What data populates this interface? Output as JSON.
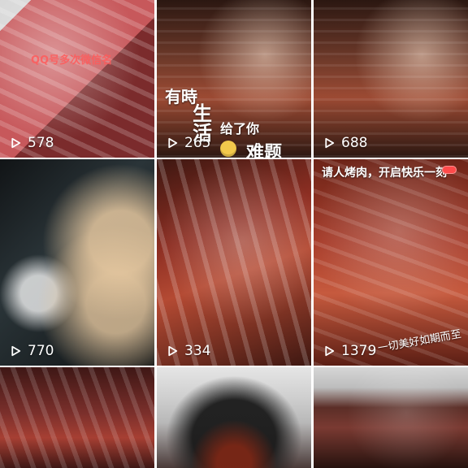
{
  "grid": {
    "tiles": [
      {
        "views": "578",
        "watermark": "QQ号多次微信名",
        "colors": {
          "a": "#c7585b",
          "b": "#7b2b2c"
        }
      },
      {
        "views": "265",
        "text1": "有時",
        "text2": "生",
        "text3": "活",
        "text4": "给了你",
        "text5": "难题",
        "colors": {
          "a": "#6f3a2a",
          "b": "#2b1711"
        }
      },
      {
        "views": "688",
        "colors": {
          "a": "#6f3a2a",
          "b": "#2b1711"
        }
      },
      {
        "views": "770",
        "colors": {
          "a": "#2a3438",
          "b": "#111416"
        }
      },
      {
        "views": "334",
        "colors": {
          "a": "#8e2f23",
          "b": "#3d1711"
        }
      },
      {
        "views": "1379",
        "top_caption": "请人烤肉，开启快乐一刻",
        "side_caption": "一切美好如期而至",
        "colors": {
          "a": "#a73c2a",
          "b": "#5b1e14"
        }
      },
      {
        "colors": {
          "a": "#7a2f2b",
          "b": "#3e1715"
        }
      },
      {
        "colors": {
          "a": "#cfcfcf",
          "b": "#4a3a38"
        }
      },
      {
        "colors": {
          "a": "#5b2e27",
          "b": "#26120e"
        }
      }
    ]
  }
}
